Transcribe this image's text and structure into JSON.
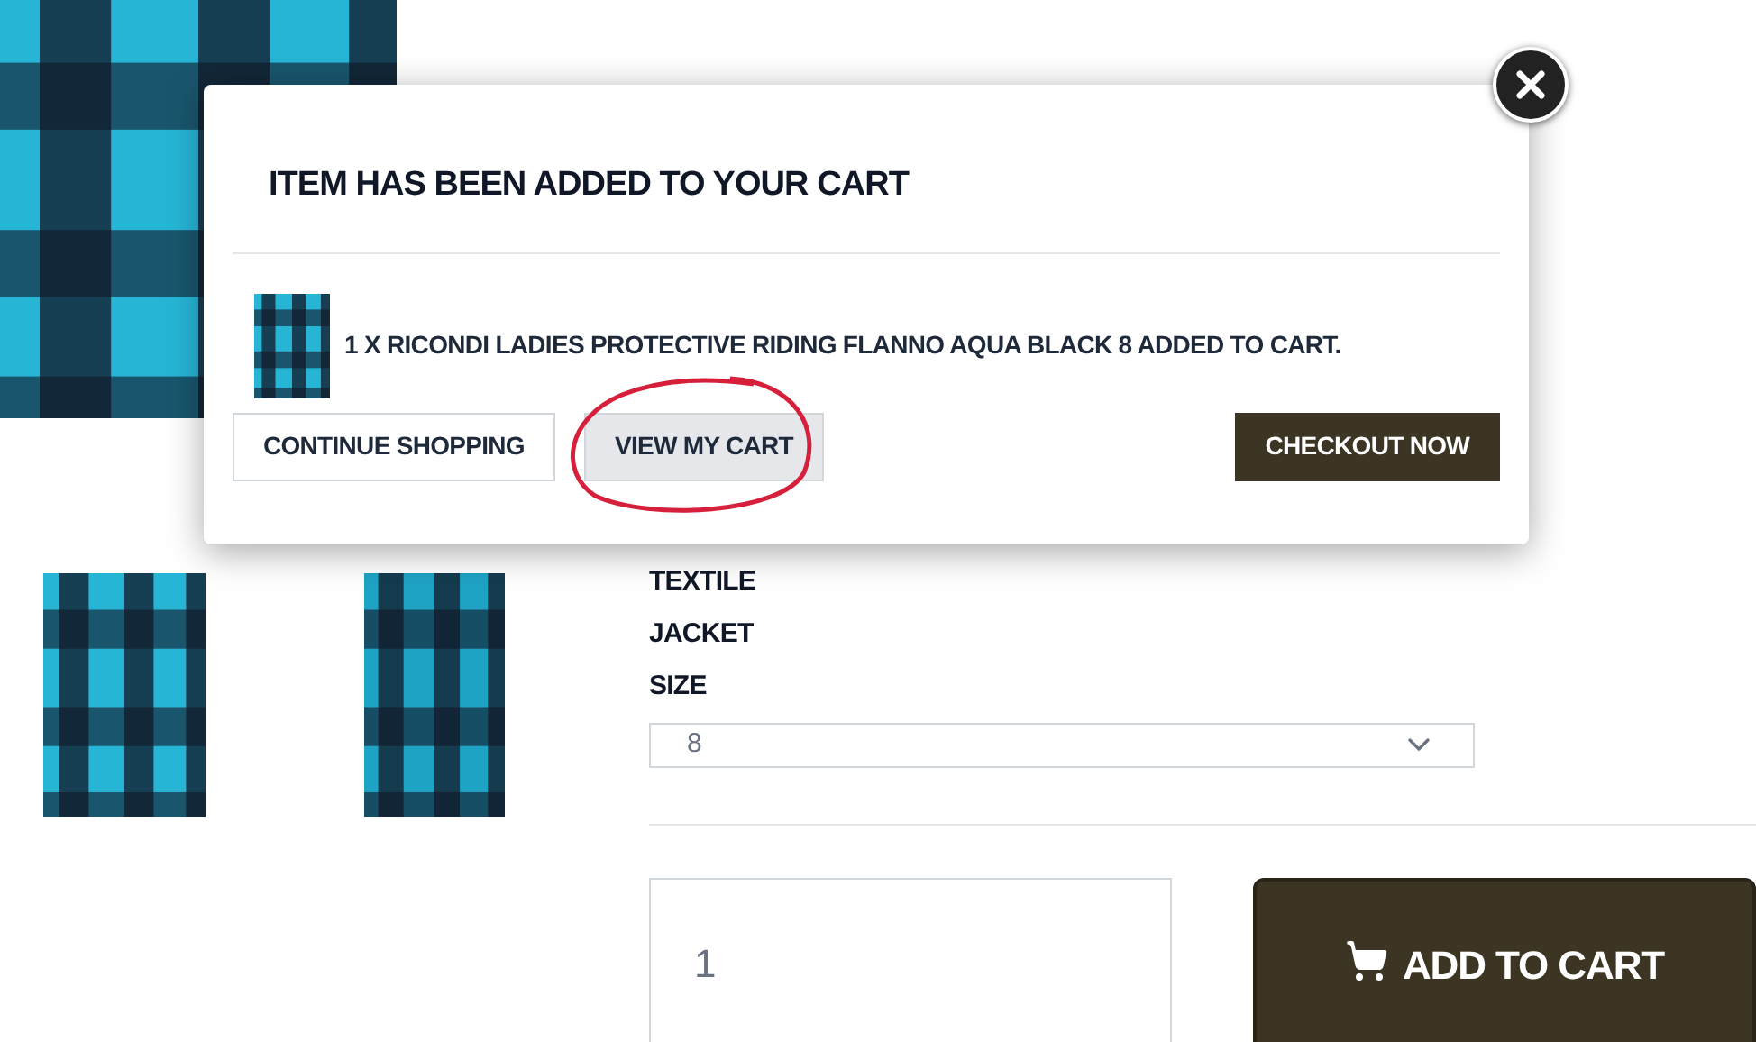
{
  "product": {
    "attributes": [
      "TEXTILE",
      "JACKET"
    ],
    "size_label": "SIZE",
    "size": {
      "value": "8"
    },
    "quantity": {
      "value": "1"
    },
    "add_button": "ADD TO CART"
  },
  "modal": {
    "title": "ITEM HAS BEEN ADDED TO YOUR CART",
    "message": "1 X RICONDI LADIES PROTECTIVE RIDING FLANNO AQUA BLACK 8 ADDED TO CART.",
    "buttons": [
      {
        "label": "CONTINUE SHOPPING",
        "kind": "outline",
        "circled": false
      },
      {
        "label": "VIEW MY CART",
        "kind": "grey",
        "circled": true
      },
      {
        "label": "CHECKOUT NOW",
        "kind": "dark",
        "circled": false
      }
    ]
  }
}
